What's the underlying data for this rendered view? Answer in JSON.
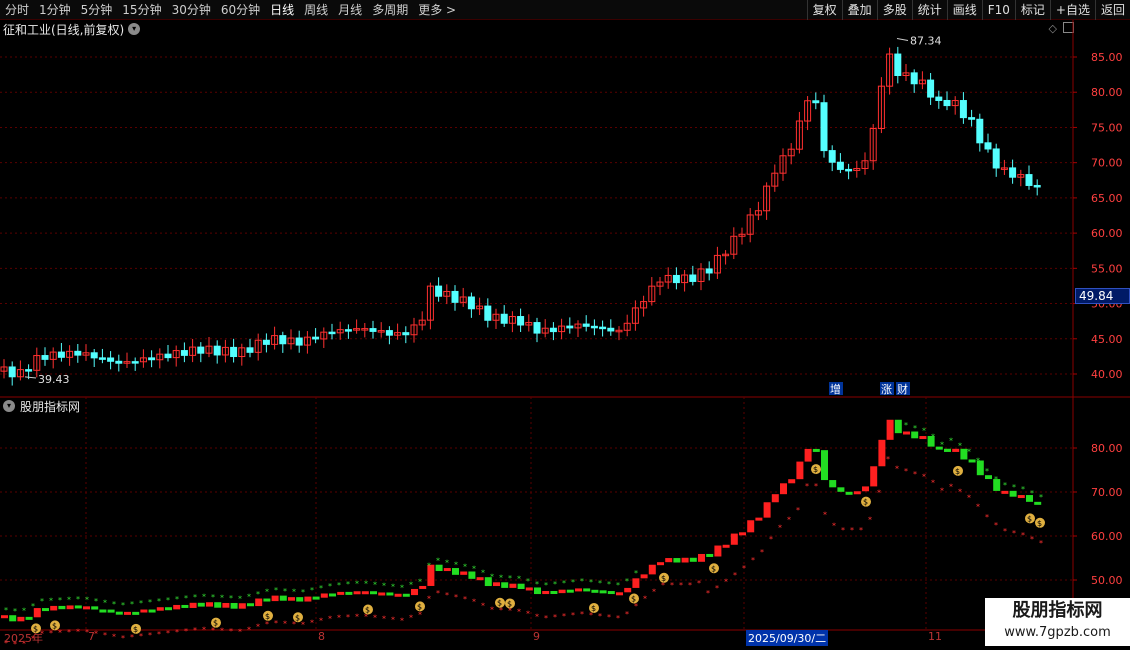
{
  "toolbar": {
    "left": [
      "分时",
      "1分钟",
      "5分钟",
      "15分钟",
      "30分钟",
      "60分钟",
      "日线",
      "周线",
      "月线",
      "多周期",
      "更多 >"
    ],
    "right": [
      "复权",
      "叠加",
      "多股",
      "统计",
      "画线",
      "F10",
      "标记",
      "+自选",
      "返回"
    ]
  },
  "main_panel": {
    "title": "征和工业(日线,前复权)",
    "price_axis": [
      "85.00",
      "80.00",
      "75.00",
      "70.00",
      "65.00",
      "60.00",
      "55.00",
      "50.00",
      "45.00",
      "40.00"
    ],
    "high_label": "87.34",
    "low_label": "39.43",
    "current_price_tag": "49.84",
    "event_tags": [
      "增",
      "涨",
      "财"
    ]
  },
  "indicator_panel": {
    "title": "股朋指标网",
    "axis": [
      "80.00",
      "70.00",
      "60.00",
      "50.00"
    ]
  },
  "date_axis": {
    "labels": [
      "2025年",
      "7",
      "8",
      "9",
      "2025/09/30/二",
      "11"
    ]
  },
  "watermark": {
    "line1": "股朋指标网",
    "line2": "www.7gpzb.com"
  },
  "colors": {
    "up": "#ff3030",
    "down": "#54ffff",
    "grid": "#5a0000",
    "axis_text": "#ff4040"
  },
  "chart_data": {
    "type": "candlestick",
    "title": "征和工业(日线,前复权)",
    "ylim": [
      38,
      88
    ],
    "x_period_labels": [
      "7",
      "8",
      "9",
      "2025/09/30/二",
      "11"
    ],
    "close_approx": [
      40.5,
      39.8,
      42.5,
      42.0,
      43.0,
      42.5,
      41.0,
      41.8,
      42.0,
      43.5,
      44.0,
      44.5,
      45.0,
      46.5,
      46.2,
      52.0,
      51.5,
      48.5,
      47.5,
      46.0,
      46.5,
      47.5,
      46.0,
      50.0,
      53.0,
      52.5,
      54.5,
      56.0,
      60.0,
      67.0,
      80.0,
      72.0,
      70.0,
      86.0,
      80.0,
      78.0,
      77.0,
      74.0,
      70.0,
      68.0,
      66.0
    ],
    "high": 87.34,
    "low": 39.43
  }
}
